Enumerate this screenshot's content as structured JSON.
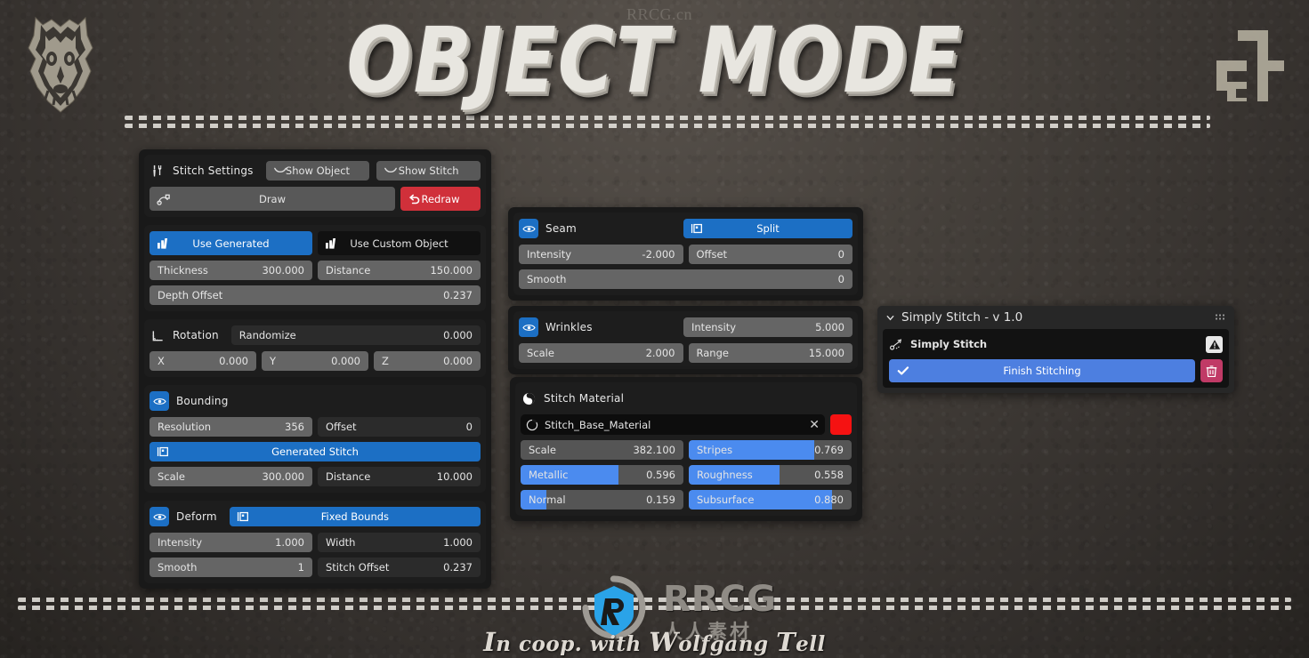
{
  "header": {
    "title": "OBJECT MODE",
    "watermark_top": "RRCG.cn",
    "left_logo_icon": "wolf-head-logo",
    "right_logo_icon": "brand-mark-logo"
  },
  "footer": {
    "brand": "RRCG",
    "brand_cn": "人人素材",
    "coop_prefix": "I",
    "coop_text": "n coop. with ",
    "coop_w": "W",
    "coop_wolfgang": "olfgang ",
    "coop_t": "T",
    "coop_tell": "ell",
    "coop_full": "In coop. with Wolfgang Tell"
  },
  "colors": {
    "accent_blue": "#1c6fc4",
    "slider_blue": "#4b8bef",
    "finish_blue": "#4d7fe0",
    "redraw_red": "#d0303a",
    "material_swatch": "#f51212",
    "trash_pink": "#c03a66",
    "panel_bg": "#191919",
    "block_bg": "#1d1d1d",
    "field_grey": "#656565"
  },
  "left_panel": {
    "stitch_settings": {
      "icon": "tools-icon",
      "title": "Stitch Settings",
      "show_object": {
        "label": "Show Object",
        "icon": "eye-closed-icon"
      },
      "show_stitch": {
        "label": "Show Stitch",
        "icon": "eye-closed-icon"
      },
      "draw": {
        "label": "Draw",
        "icon": "draw-curve-icon"
      },
      "redraw": {
        "label": "Redraw",
        "icon": "undo-arrow-icon"
      }
    },
    "source": {
      "use_generated": {
        "label": "Use Generated",
        "icon": "mesh-data-icon",
        "active": true
      },
      "use_custom_object": {
        "label": "Use Custom Object",
        "icon": "mesh-data-icon",
        "active": false
      },
      "thickness": {
        "label": "Thickness",
        "value": "300.000"
      },
      "distance": {
        "label": "Distance",
        "value": "150.000"
      },
      "depth_offset": {
        "label": "Depth Offset",
        "value": "0.237"
      }
    },
    "rotation": {
      "icon": "rotation-angle-icon",
      "title": "Rotation",
      "randomize": {
        "label": "Randomize",
        "value": "0.000"
      },
      "x": {
        "label": "X",
        "value": "0.000"
      },
      "y": {
        "label": "Y",
        "value": "0.000"
      },
      "z": {
        "label": "Z",
        "value": "0.000"
      }
    },
    "bounding": {
      "icon": "eye-icon",
      "title": "Bounding",
      "resolution": {
        "label": "Resolution",
        "value": "356"
      },
      "offset": {
        "label": "Offset",
        "value": "0"
      },
      "generated_stitch": {
        "label": "Generated Stitch",
        "icon": "object-bounds-icon"
      },
      "scale": {
        "label": "Scale",
        "value": "300.000"
      },
      "distance": {
        "label": "Distance",
        "value": "10.000"
      }
    },
    "deform": {
      "icon": "eye-icon",
      "title": "Deform",
      "fixed_bounds": {
        "label": "Fixed Bounds",
        "icon": "object-bounds-icon"
      },
      "intensity": {
        "label": "Intensity",
        "value": "1.000"
      },
      "width": {
        "label": "Width",
        "value": "1.000"
      },
      "smooth": {
        "label": "Smooth",
        "value": "1"
      },
      "stitch_offset": {
        "label": "Stitch Offset",
        "value": "0.237"
      }
    }
  },
  "middle_panel": {
    "seam": {
      "icon": "eye-icon",
      "title": "Seam",
      "split": {
        "label": "Split",
        "icon": "object-bounds-icon"
      },
      "intensity": {
        "label": "Intensity",
        "value": "-2.000"
      },
      "offset": {
        "label": "Offset",
        "value": "0"
      },
      "smooth": {
        "label": "Smooth",
        "value": "0"
      }
    },
    "wrinkles": {
      "icon": "eye-icon",
      "title": "Wrinkles",
      "intensity": {
        "label": "Intensity",
        "value": "5.000"
      },
      "scale": {
        "label": "Scale",
        "value": "2.000"
      },
      "range": {
        "label": "Range",
        "value": "15.000"
      }
    },
    "stitch_material": {
      "icon": "material-sphere-icon",
      "title": "Stitch Material",
      "name_field": {
        "icon": "material-browse-icon",
        "value": "Stitch_Base_Material",
        "clear_icon": "close-icon"
      },
      "swatch_color": "#f51212",
      "scale": {
        "label": "Scale",
        "value": "382.100",
        "fill": 0
      },
      "stripes": {
        "label": "Stripes",
        "value": "0.769",
        "fill": 77
      },
      "metallic": {
        "label": "Metallic",
        "value": "0.596",
        "fill": 60
      },
      "roughness": {
        "label": "Roughness",
        "value": "0.558",
        "fill": 56
      },
      "normal": {
        "label": "Normal",
        "value": "0.159",
        "fill": 16
      },
      "subsurface": {
        "label": "Subsurface",
        "value": "0.880",
        "fill": 88
      }
    }
  },
  "right_panel": {
    "title": "Simply Stitch - v 1.0",
    "collapse_icon": "chevron-down-icon",
    "grip_icon": "drag-grip-icon",
    "modifier": {
      "icon": "simply-stitch-icon",
      "name": "Simply Stitch",
      "warning_icon": "warning-triangle-icon"
    },
    "finish": {
      "label": "Finish Stitching",
      "icon": "check-icon"
    },
    "delete_icon": "trash-icon"
  }
}
